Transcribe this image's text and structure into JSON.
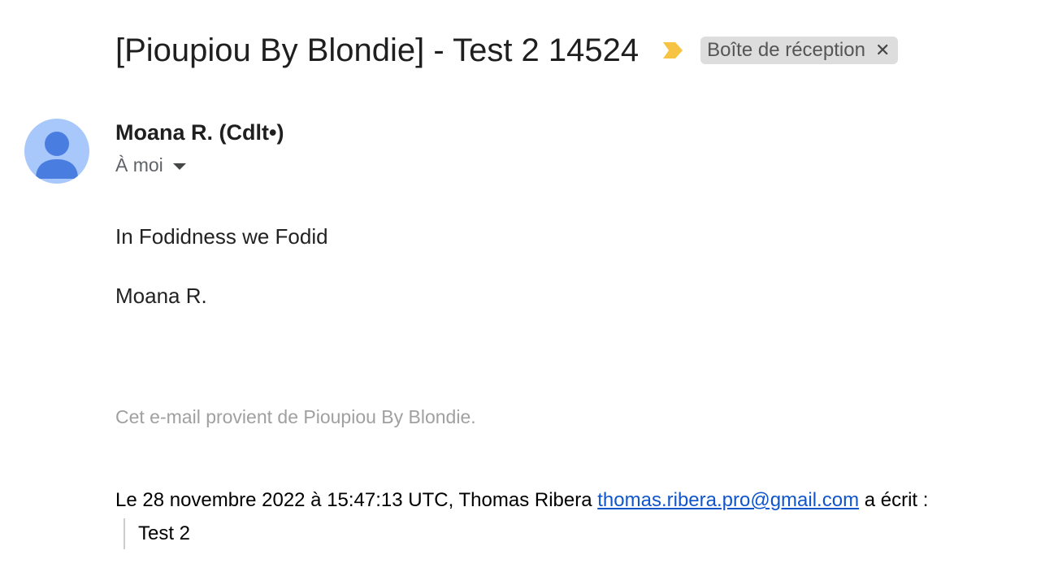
{
  "email": {
    "subject": "[Pioupiou By Blondie] - Test 2 14524",
    "label": "Boîte de réception",
    "label_close_icon": "close-icon",
    "importance_color": "#f6c442",
    "sender": {
      "name": "Moana R. (Cdlt•)",
      "recipient_label": "À moi",
      "avatar_bg": "#a8c7fa",
      "avatar_fg": "#4a7de0"
    },
    "body": {
      "line1": "In Fodidness we Fodid",
      "line2": "Moana R."
    },
    "footer_note": "Cet e-mail provient de Pioupiou By Blondie.",
    "quote": {
      "intro": "Le 28 novembre 2022 à 15:47:13 UTC, Thomas Ribera",
      "email_link": "thomas.ribera.pro@gmail.com",
      "suffix": "a écrit :",
      "quoted_text": "Test 2"
    }
  }
}
